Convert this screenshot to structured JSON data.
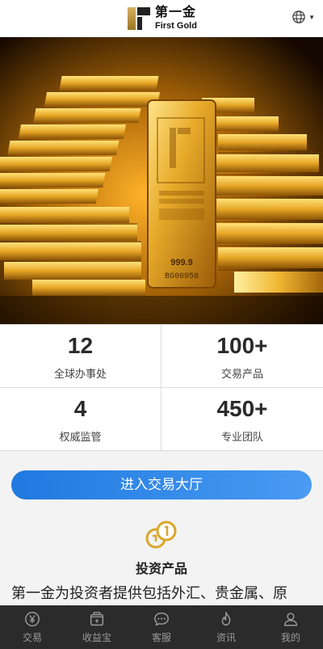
{
  "header": {
    "logo_cn": "第一金",
    "logo_en": "First Gold",
    "language_icon": "globe-icon"
  },
  "hero": {
    "bar_stamp": "999.9",
    "bar_serial": "BG00958"
  },
  "stats": [
    {
      "value": "12",
      "label": "全球办事处"
    },
    {
      "value": "100+",
      "label": "交易产品"
    },
    {
      "value": "4",
      "label": "权威监管"
    },
    {
      "value": "450+",
      "label": "专业团队"
    }
  ],
  "cta": {
    "label": "进入交易大厅"
  },
  "products": {
    "icon": "coins-icon",
    "title": "投资产品",
    "description": "第一金为投资者提供包括外汇、贵金属、原"
  },
  "tabbar": [
    {
      "label": "交易",
      "icon": "yen-coin-icon"
    },
    {
      "label": "收益宝",
      "icon": "wallet-icon"
    },
    {
      "label": "客服",
      "icon": "chat-icon"
    },
    {
      "label": "资讯",
      "icon": "flame-icon"
    },
    {
      "label": "我的",
      "icon": "user-icon"
    }
  ],
  "colors": {
    "accent": "#2a85e8",
    "tabbar_bg": "#2b2b2b",
    "gold": "#d9a72a"
  }
}
